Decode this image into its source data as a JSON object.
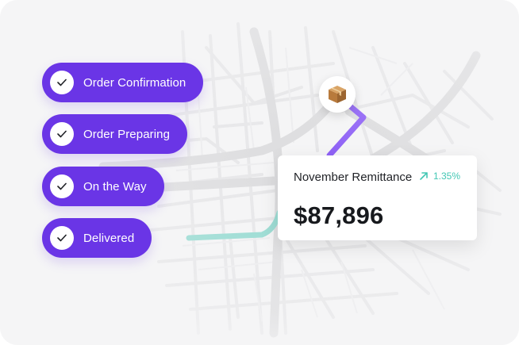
{
  "statuses": [
    {
      "label": "Order Confirmation",
      "icon": "check-icon",
      "state": "complete"
    },
    {
      "label": "Order Preparing",
      "icon": "check-icon",
      "state": "complete"
    },
    {
      "label": "On the Way",
      "icon": "check-icon",
      "state": "complete"
    },
    {
      "label": "Delivered",
      "icon": "check-icon",
      "state": "complete"
    }
  ],
  "remittance": {
    "title": "November Remittance",
    "change_icon": "arrow-up-right-icon",
    "change": "1.35%",
    "amount": "$87,896"
  },
  "map": {
    "marker_icon": "package-icon",
    "route_traveled_color": "#8b5cf6",
    "route_remaining_color": "#8fd9cf"
  },
  "colors": {
    "accent": "#6a35e6",
    "positive": "#43c7b4"
  }
}
